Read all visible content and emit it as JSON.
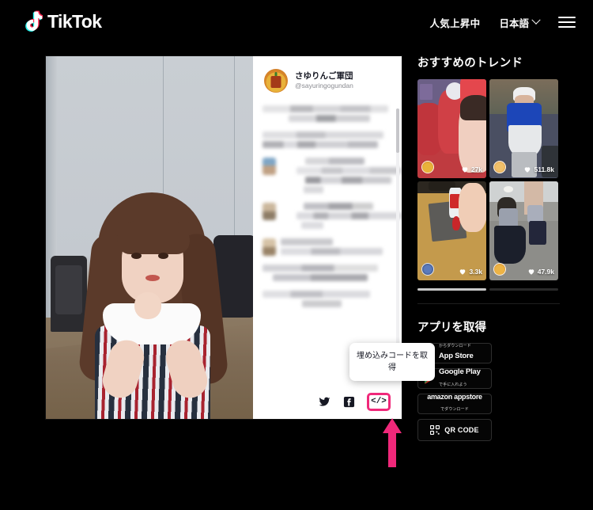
{
  "header": {
    "brand": "TikTok",
    "trending_label": "人気上昇中",
    "language_label": "日本語",
    "menu_icon": "hamburger-menu-icon"
  },
  "video_card": {
    "author_name": "さゆりんご軍団",
    "author_handle": "@sayuringogundan",
    "comments_masked": true,
    "share": {
      "twitter_icon": "twitter-icon",
      "facebook_icon": "facebook-icon",
      "embed_code_label": "</>"
    },
    "tooltip_text": "埋め込みコードを取得"
  },
  "sidebar": {
    "trends_title": "おすすめのトレンド",
    "trends": [
      {
        "likes": "27k",
        "theme": "red-costume-group"
      },
      {
        "likes": "511.8k",
        "theme": "blue-jacket-outdoor"
      },
      {
        "likes": "3.3k",
        "theme": "hand-craft-paint"
      },
      {
        "likes": "47.9k",
        "theme": "uniform-dance-hall"
      }
    ],
    "apps_title": "アプリを取得",
    "apps": [
      {
        "name": "App Store",
        "sub": "からダウンロード",
        "icon": "apple-icon"
      },
      {
        "name": "Google Play",
        "sub": "で手に入れよう",
        "icon": "google-play-icon"
      },
      {
        "name": "amazon appstore",
        "sub": "でダウンロード",
        "icon": "amazon-icon"
      },
      {
        "name": "QR CODE",
        "sub": "",
        "icon": "qr-code-icon"
      }
    ]
  },
  "annotation": {
    "highlight_color": "#f0287a",
    "arrow_color": "#f0287a",
    "points_to": "embed-code-button"
  }
}
